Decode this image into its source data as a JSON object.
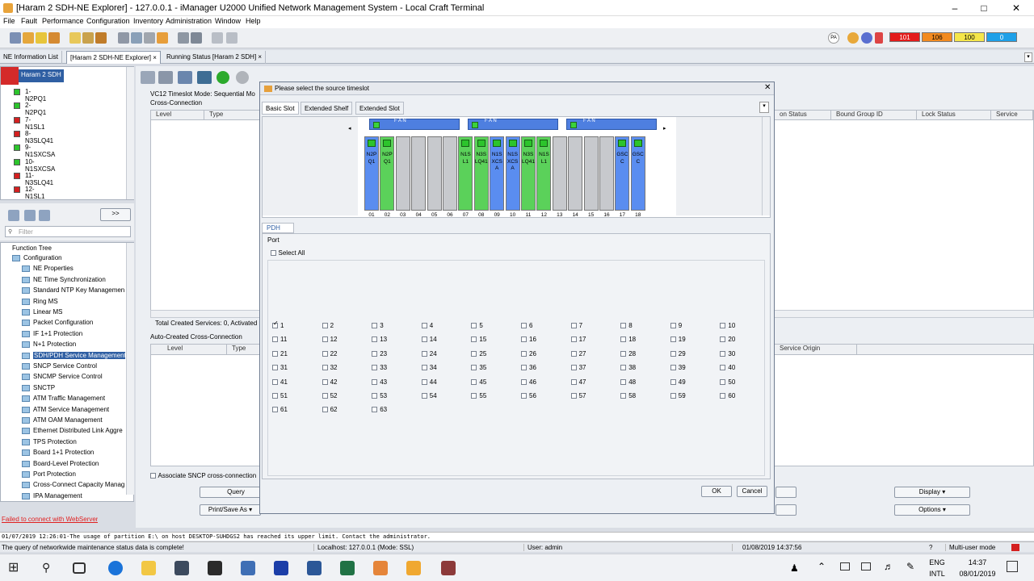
{
  "window": {
    "title": "[Haram 2 SDH-NE Explorer] - 127.0.0.1 - iManager U2000 Unified Network Management System - Local Craft Terminal"
  },
  "menu": [
    "File",
    "Fault",
    "Performance",
    "Configuration",
    "Inventory",
    "Administration",
    "Window",
    "Help"
  ],
  "alarm_counts": {
    "critical": "101",
    "major": "106",
    "minor": "100",
    "warning": "0",
    "pa": "PA"
  },
  "tabs": [
    {
      "label": "NE Information List"
    },
    {
      "label": "[Haram 2 SDH-NE Explorer]",
      "close": "×"
    },
    {
      "label": "Running Status [Haram 2 SDH]",
      "close": "×"
    }
  ],
  "ne_name": "Haram 2 SDH",
  "boards": [
    {
      "label": "1-N2PQ1",
      "color": "#2cc42c"
    },
    {
      "label": "2-N2PQ1",
      "color": "#2cc42c"
    },
    {
      "label": "7-N1SL1",
      "color": "#d42020"
    },
    {
      "label": "8-N3SLQ41",
      "color": "#d42020"
    },
    {
      "label": "9-N1SXCSA",
      "color": "#2cc42c"
    },
    {
      "label": "10-N1SXCSA",
      "color": "#2cc42c"
    },
    {
      "label": "11-N3SLQ41",
      "color": "#d42020"
    },
    {
      "label": "12-N1SL1",
      "color": "#d42020"
    }
  ],
  "left_panel": {
    "expand_btn": ">>",
    "filter_placeholder": "Filter",
    "function_tree_title": "Function Tree",
    "web_error": "Failed to connect with WebServer"
  },
  "function_tree": [
    {
      "label": "Configuration",
      "level": 0
    },
    {
      "label": "NE Properties",
      "level": 1
    },
    {
      "label": "NE Time Synchronization",
      "level": 1
    },
    {
      "label": "Standard NTP Key Managemen",
      "level": 1
    },
    {
      "label": "Ring MS",
      "level": 1
    },
    {
      "label": "Linear MS",
      "level": 1
    },
    {
      "label": "Packet Configuration",
      "level": 1
    },
    {
      "label": "IF 1+1 Protection",
      "level": 1
    },
    {
      "label": "N+1 Protection",
      "level": 1
    },
    {
      "label": "SDH/PDH Service Management",
      "level": 1,
      "selected": true
    },
    {
      "label": "SNCP Service Control",
      "level": 1
    },
    {
      "label": "SNCMP Service Control",
      "level": 1
    },
    {
      "label": "SNCTP",
      "level": 1
    },
    {
      "label": "ATM Traffic Management",
      "level": 1
    },
    {
      "label": "ATM Service Management",
      "level": 1
    },
    {
      "label": "ATM OAM Management",
      "level": 1
    },
    {
      "label": "Ethernet Distributed Link Aggre",
      "level": 1
    },
    {
      "label": "TPS Protection",
      "level": 1
    },
    {
      "label": "Board 1+1 Protection",
      "level": 1
    },
    {
      "label": "Board-Level Protection",
      "level": 1
    },
    {
      "label": "Port Protection",
      "level": 1
    },
    {
      "label": "Cross-Connect Capacity Manag",
      "level": 1
    },
    {
      "label": "IPA Management",
      "level": 1
    }
  ],
  "main": {
    "timeslot_mode": "VC12 Timeslot Mode: Sequential Mo",
    "cross_connection": "Cross-Connection",
    "cols_left": [
      "Level",
      "Type"
    ],
    "cols_right": [
      "on Status",
      "Bound Group ID",
      "Lock Status",
      "Service"
    ],
    "total_services": "Total Created Services: 0, Activated",
    "auto_created": "Auto-Created Cross-Connection",
    "auto_cols": [
      "Level",
      "Type"
    ],
    "auto_col_right": "Service Origin",
    "assoc_sncp": "Associate SNCP cross-connection",
    "query": "Query",
    "print_save": "Print/Save As",
    "display": "Display",
    "options": "Options"
  },
  "dialog": {
    "title": "Please select the source timeslot",
    "subtabs": [
      "Basic Slot",
      "Extended Shelf",
      "Extended Slot"
    ],
    "fans": [
      "F A N",
      "F A N",
      "F A N"
    ],
    "slots": [
      {
        "num": "01",
        "label": "N2PQ1",
        "color": "blue"
      },
      {
        "num": "02",
        "label": "N2PQ1",
        "color": "green"
      },
      {
        "num": "03",
        "label": "",
        "color": "empty"
      },
      {
        "num": "04",
        "label": "",
        "color": "empty"
      },
      {
        "num": "05",
        "label": "",
        "color": "empty"
      },
      {
        "num": "06",
        "label": "",
        "color": "empty"
      },
      {
        "num": "07",
        "label": "N1SL1",
        "color": "green"
      },
      {
        "num": "08",
        "label": "N3SLQ41",
        "color": "green"
      },
      {
        "num": "09",
        "label": "N1SXCSA",
        "color": "blue"
      },
      {
        "num": "10",
        "label": "N1SXCSA",
        "color": "blue"
      },
      {
        "num": "11",
        "label": "N3SLQ41",
        "color": "green"
      },
      {
        "num": "12",
        "label": "N1SL1",
        "color": "green"
      },
      {
        "num": "13",
        "label": "",
        "color": "empty"
      },
      {
        "num": "14",
        "label": "",
        "color": "empty"
      },
      {
        "num": "15",
        "label": "",
        "color": "empty"
      },
      {
        "num": "16",
        "label": "",
        "color": "empty"
      },
      {
        "num": "17",
        "label": "GSCC",
        "color": "blue"
      },
      {
        "num": "18",
        "label": "GSCC",
        "color": "blue"
      }
    ],
    "pdh_tab": "PDH",
    "port_label": "Port",
    "select_all": "Select All",
    "ports": [
      "1",
      "2",
      "3",
      "4",
      "5",
      "6",
      "7",
      "8",
      "9",
      "10",
      "11",
      "12",
      "13",
      "14",
      "15",
      "16",
      "17",
      "18",
      "19",
      "20",
      "21",
      "22",
      "23",
      "24",
      "25",
      "26",
      "27",
      "28",
      "29",
      "30",
      "31",
      "32",
      "33",
      "34",
      "35",
      "36",
      "37",
      "38",
      "39",
      "40",
      "41",
      "42",
      "43",
      "44",
      "45",
      "46",
      "47",
      "48",
      "49",
      "50",
      "51",
      "52",
      "53",
      "54",
      "55",
      "56",
      "57",
      "58",
      "59",
      "60",
      "61",
      "62",
      "63"
    ],
    "checked_port": "1",
    "ok": "OK",
    "cancel": "Cancel"
  },
  "status": {
    "log": "01/07/2019 12:26:01-The usage of partition E:\\ on host DESKTOP-SUHDGS2 has reached its upper limit. Contact the administrator.",
    "query_msg": "The query of networkwide maintenance status data is complete!",
    "host": "Localhost: 127.0.0.1 (Mode: SSL)",
    "user": "User: admin",
    "datetime": "01/08/2019 14:37:56",
    "mode": "Multi-user mode"
  },
  "taskbar": {
    "lang1": "ENG",
    "lang2": "INTL",
    "time": "14:37",
    "date": "08/01/2019"
  }
}
